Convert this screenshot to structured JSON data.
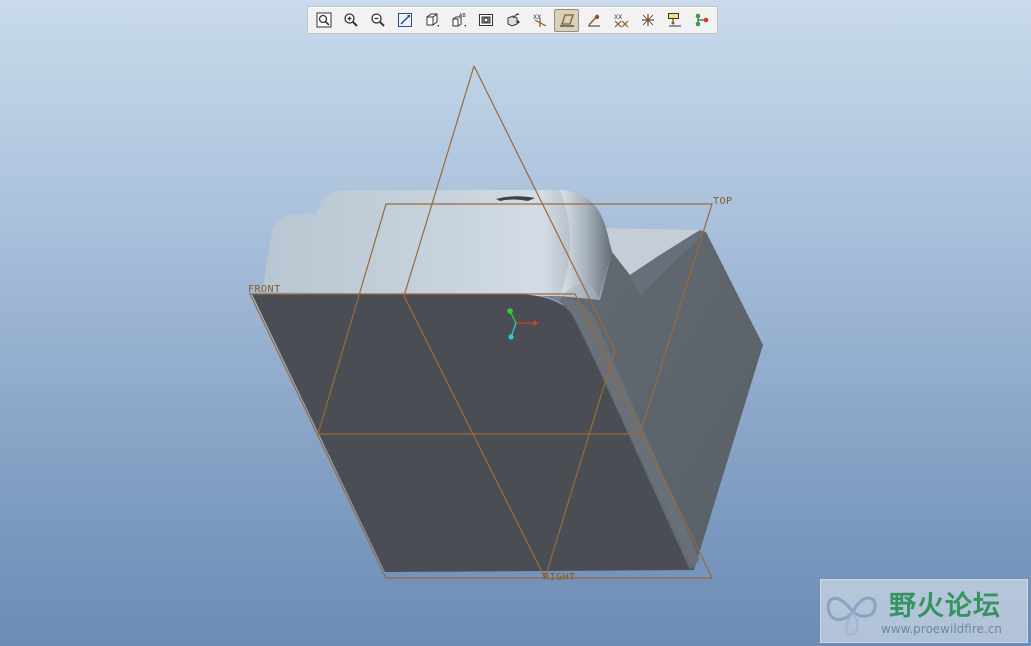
{
  "toolbar": {
    "buttons": [
      {
        "icon": "refit-icon"
      },
      {
        "icon": "zoom-in-icon"
      },
      {
        "icon": "zoom-out-icon"
      },
      {
        "icon": "repaint-icon"
      },
      {
        "icon": "orient-icon"
      },
      {
        "icon": "saved-views-icon"
      },
      {
        "icon": "layers-icon"
      },
      {
        "icon": "model-display-icon"
      },
      {
        "icon": "datum-axis-display-icon"
      },
      {
        "icon": "datum-plane-display-icon",
        "active": true
      },
      {
        "icon": "spin-center-icon"
      },
      {
        "icon": "datum-point-display-icon"
      },
      {
        "icon": "coordinate-system-display-icon"
      },
      {
        "icon": "annotation-display-icon"
      },
      {
        "icon": "network-icon"
      }
    ]
  },
  "datums": {
    "front": "FRONT",
    "top": "TOP",
    "right": "RIGHT"
  },
  "colors": {
    "datum": "#9a6a38",
    "front_face": "#4b4e55",
    "side_face": "#5c636b",
    "top_face": "#c0ccd6",
    "csys_x": "#e03a2a",
    "csys_y": "#2fcf3a",
    "csys_z": "#2ac8d8"
  },
  "watermark": {
    "title": "野火论坛",
    "url": "www.proewildfire.cn"
  }
}
